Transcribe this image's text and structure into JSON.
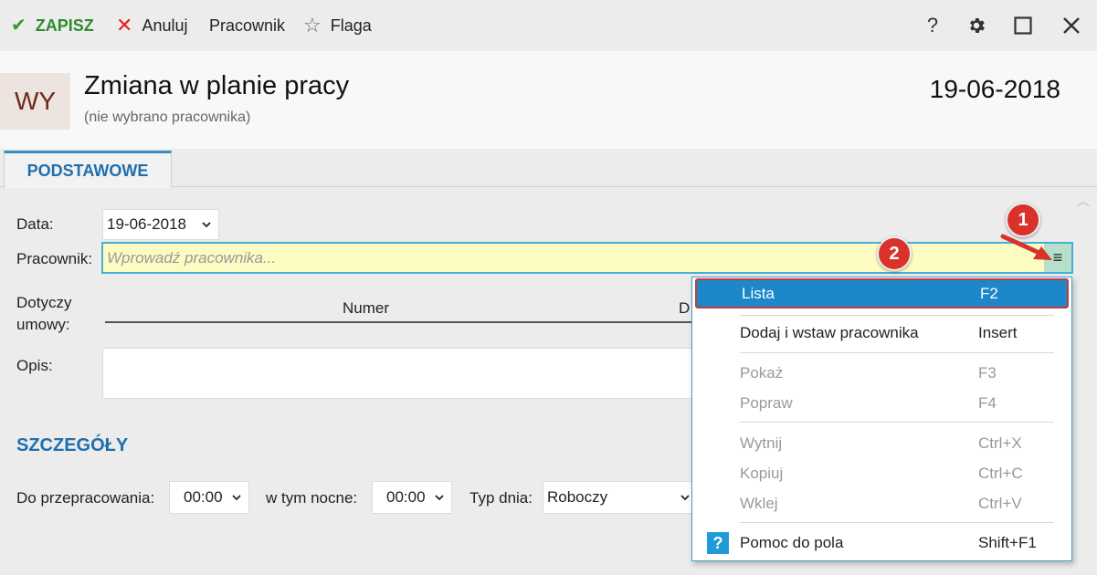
{
  "toolbar": {
    "save_label": "ZAPISZ",
    "cancel_label": "Anuluj",
    "employee_label": "Pracownik",
    "flag_label": "Flaga",
    "help_icon": "?",
    "save_icon": "checkmark-icon",
    "cancel_icon": "x-icon",
    "flag_icon": "star-icon",
    "settings_icon": "gear-icon",
    "maximize_icon": "maximize-icon",
    "close_icon": "close-icon"
  },
  "header": {
    "avatar": "WY",
    "title": "Zmiana w planie pracy",
    "subtitle": "(nie wybrano pracownika)",
    "date": "19-06-2018"
  },
  "tabs": [
    {
      "label": "PODSTAWOWE",
      "active": true
    }
  ],
  "form": {
    "date_label": "Data:",
    "date_value": "19-06-2018",
    "employee_label": "Pracownik:",
    "employee_placeholder": "Wprowadź pracownika...",
    "employee_menu_icon": "≡",
    "contract_label_1": "Dotyczy",
    "contract_label_2": "umowy:",
    "contract_columns": [
      "Numer",
      "D"
    ],
    "description_label": "Opis:"
  },
  "details": {
    "title": "SZCZEGÓŁY",
    "work_label": "Do przepracowania:",
    "work_value": "00:00",
    "night_label": "w tym nocne:",
    "night_value": "00:00",
    "daytype_label": "Typ dnia:",
    "daytype_value": "Roboczy"
  },
  "context_menu": {
    "items": [
      {
        "label": "Lista",
        "shortcut": "F2",
        "state": "highlighted"
      },
      {
        "label": "Dodaj i wstaw pracownika",
        "shortcut": "Insert",
        "state": "enabled"
      },
      {
        "label": "Pokaż",
        "shortcut": "F3",
        "state": "disabled"
      },
      {
        "label": "Popraw",
        "shortcut": "F4",
        "state": "disabled"
      },
      {
        "label": "Wytnij",
        "shortcut": "Ctrl+X",
        "state": "disabled"
      },
      {
        "label": "Kopiuj",
        "shortcut": "Ctrl+C",
        "state": "disabled"
      },
      {
        "label": "Wklej",
        "shortcut": "Ctrl+V",
        "state": "disabled"
      },
      {
        "label": "Pomoc do pola",
        "shortcut": "Shift+F1",
        "state": "enabled",
        "icon": "help-icon"
      }
    ],
    "help_glyph": "?"
  },
  "callouts": [
    "1",
    "2"
  ],
  "colors": {
    "accent": "#1f6fae",
    "highlight": "#1c87c9",
    "callout": "#d8322b",
    "field_bg": "#fcfcc2"
  }
}
